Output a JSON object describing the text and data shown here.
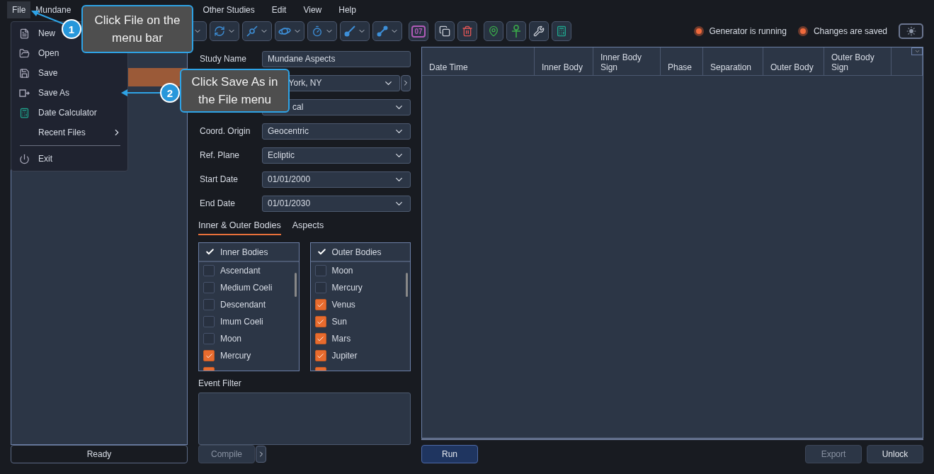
{
  "menu_bar": {
    "items": [
      {
        "label": "File",
        "selected": true
      },
      {
        "label": "Mundane",
        "selected": false
      },
      {
        "label": "Other Studies",
        "selected": false
      },
      {
        "label": "Edit",
        "selected": false
      },
      {
        "label": "View",
        "selected": false
      },
      {
        "label": "Help",
        "selected": false
      }
    ]
  },
  "file_menu": {
    "items": [
      {
        "kind": "new",
        "label": "New"
      },
      {
        "kind": "open",
        "label": "Open"
      },
      {
        "kind": "save",
        "label": "Save"
      },
      {
        "kind": "save_as",
        "label": "Save As"
      },
      {
        "kind": "calculator",
        "label": "Date Calculator"
      },
      {
        "kind": "submenu",
        "label": "Recent Files"
      },
      {
        "kind": "separator"
      },
      {
        "kind": "exit",
        "label": "Exit"
      }
    ]
  },
  "callouts": [
    {
      "number": "1",
      "text": "Click File on the menu bar"
    },
    {
      "number": "2",
      "text": "Click Save As in the File menu"
    }
  ],
  "toolbar": {
    "calendar_label": "07"
  },
  "status_lights": [
    {
      "label": "Generator is running",
      "on": true
    },
    {
      "label": "Changes are saved",
      "on": true
    }
  ],
  "form": {
    "fields": [
      {
        "label": "Study Name",
        "value": "Mundane Aspects",
        "kind": "text"
      },
      {
        "value": "York, NY",
        "kind": "location"
      },
      {
        "value": "cal",
        "kind": "select"
      },
      {
        "label": "Coord. Origin",
        "value": "Geocentric",
        "kind": "select"
      },
      {
        "label": "Ref. Plane",
        "value": "Ecliptic",
        "kind": "select"
      },
      {
        "label": "Start Date",
        "value": "01/01/2000",
        "kind": "select"
      },
      {
        "label": "End Date",
        "value": "01/01/2030",
        "kind": "select"
      }
    ]
  },
  "tabs": [
    {
      "label": "Inner & Outer Bodies",
      "selected": true
    },
    {
      "label": "Aspects",
      "selected": false
    }
  ],
  "inner_bodies": {
    "title": "Inner Bodies",
    "items": [
      {
        "label": "Ascendant",
        "checked": false
      },
      {
        "label": "Medium Coeli",
        "checked": false
      },
      {
        "label": "Descendant",
        "checked": false
      },
      {
        "label": "Imum Coeli",
        "checked": false
      },
      {
        "label": "Moon",
        "checked": false
      },
      {
        "label": "Mercury",
        "checked": true
      },
      {
        "checked": true
      }
    ]
  },
  "outer_bodies": {
    "title": "Outer Bodies",
    "items": [
      {
        "label": "Moon",
        "checked": false
      },
      {
        "label": "Mercury",
        "checked": false
      },
      {
        "label": "Venus",
        "checked": true
      },
      {
        "label": "Sun",
        "checked": true
      },
      {
        "label": "Mars",
        "checked": true
      },
      {
        "label": "Jupiter",
        "checked": true
      },
      {
        "checked": true
      }
    ]
  },
  "event_filter": {
    "label": "Event Filter"
  },
  "table": {
    "columns": [
      "Date Time",
      "Inner Body",
      "Inner Body Sign",
      "Phase",
      "Separation",
      "Outer Body",
      "Outer Body Sign"
    ]
  },
  "status": "Ready",
  "buttons": [
    {
      "label": "Compile",
      "disabled": true,
      "kind": "compile"
    },
    {
      "label": "Run",
      "disabled": false,
      "kind": "run"
    },
    {
      "label": "Export",
      "disabled": true,
      "kind": "export"
    },
    {
      "label": "Unlock",
      "disabled": false,
      "kind": "unlock"
    }
  ]
}
